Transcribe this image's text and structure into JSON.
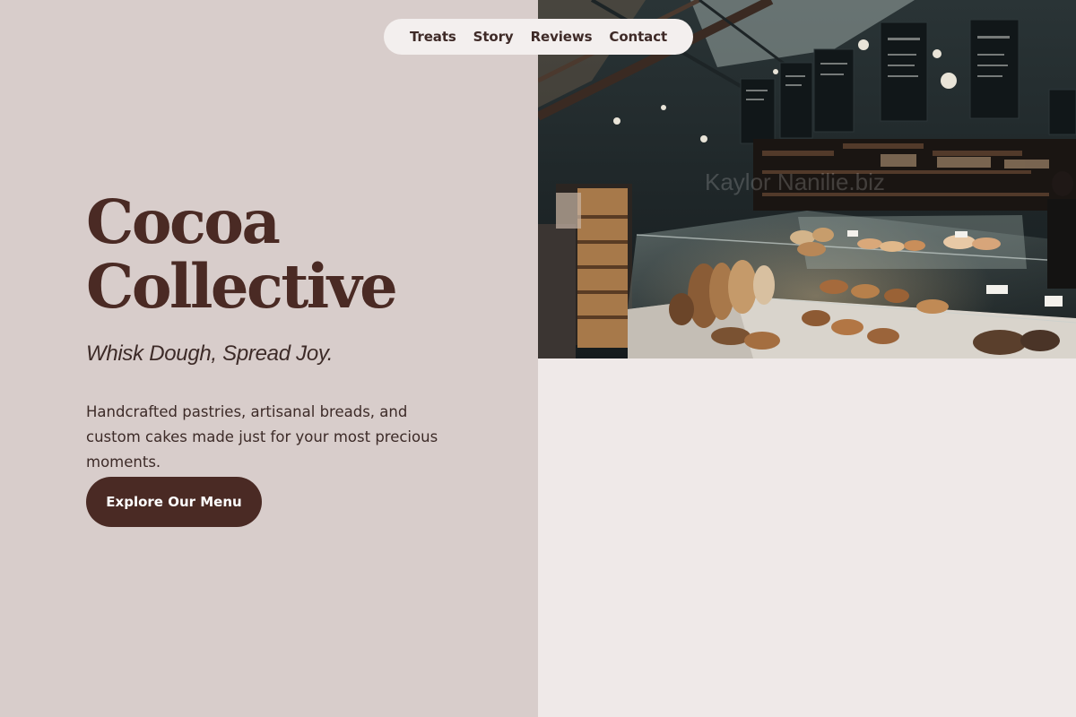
{
  "nav": {
    "items": [
      "Treats",
      "Story",
      "Reviews",
      "Contact"
    ]
  },
  "hero": {
    "title_line1": "Cocoa",
    "title_line2": "Collective",
    "tagline": "Whisk Dough, Spread Joy.",
    "description": "Handcrafted pastries, artisanal breads, and custom cakes made just for your most precious moments.",
    "cta_label": "Explore Our Menu"
  },
  "photo": {
    "alt": "Bakery interior with glass display case of breads and pastries",
    "watermark": "Kaylor Nanilie.biz"
  },
  "colors": {
    "left_panel": "#d8cdcb",
    "right_panel": "#efe9e8",
    "brand_brown": "#4a2a24",
    "text_dark": "#3d2b28"
  }
}
